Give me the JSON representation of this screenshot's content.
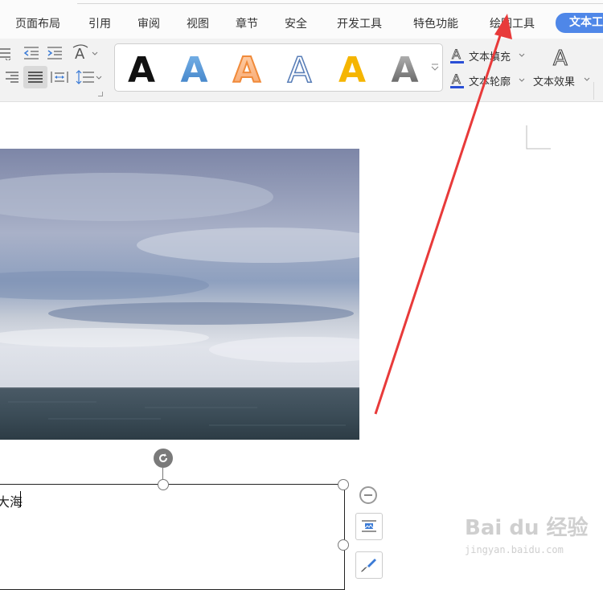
{
  "menu": {
    "items": [
      "页面布局",
      "引用",
      "审阅",
      "视图",
      "章节",
      "安全",
      "开发工具",
      "特色功能",
      "绘图工具"
    ],
    "active_tab": "文本工"
  },
  "ribbon": {
    "wordart_styles": [
      {
        "name": "black-style",
        "color": "#111111"
      },
      {
        "name": "blue-gradient-style",
        "color": "#4d93d6"
      },
      {
        "name": "orange-outline-style",
        "color": "#f08a3a"
      },
      {
        "name": "blue-outline-style",
        "color": "#5a7fb8"
      },
      {
        "name": "yellow-style",
        "color": "#f5b500"
      },
      {
        "name": "gray-gradient-style",
        "color": "#8a8a8a"
      }
    ],
    "wordart_glyph": "A",
    "text_fill_label": "文本填充",
    "text_outline_label": "文本轮廓",
    "text_effect_label": "文本效果",
    "font_size_glyph": "A"
  },
  "document": {
    "textbox_text": "大海"
  },
  "watermark": {
    "brand": "Bai du 经验",
    "url": "jingyan.baidu.com"
  },
  "colors": {
    "accent": "#4f87e8",
    "arrow": "#e83a3a"
  }
}
